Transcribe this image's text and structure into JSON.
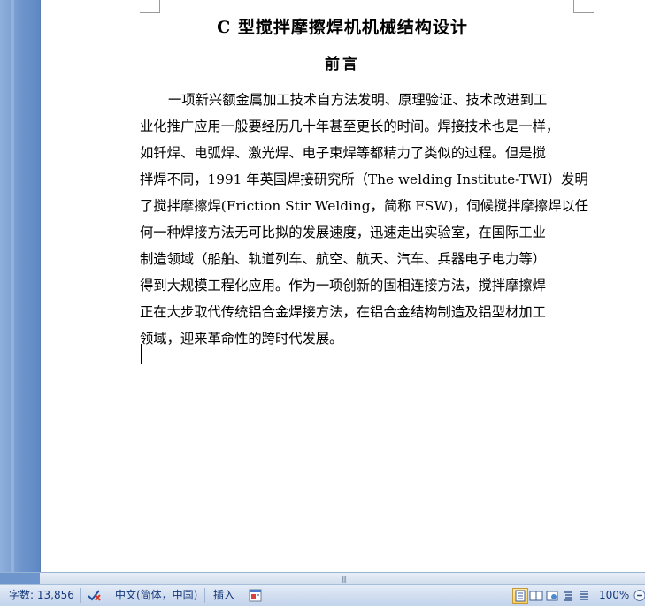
{
  "document": {
    "title": "C 型搅拌摩擦焊机机械结构设计",
    "heading": "前言",
    "paragraph_lines": [
      "一项新兴额金属加工技术自方法发明、原理验证、技术改进到工",
      "业化推广应用一般要经历几十年甚至更长的时间。焊接技术也是一样，",
      "如钎焊、电弧焊、激光焊、电子束焊等都精力了类似的过程。但是搅",
      "拌焊不同，1991 年英国焊接研究所（The welding Institute-TWI）发明",
      "了搅拌摩擦焊(Friction Stir Welding，简称 FSW)，伺候搅拌摩擦焊以任",
      "何一种焊接方法无可比拟的发展速度，迅速走出实验室，在国际工业",
      "制造领域（船舶、轨道列车、航空、航天、汽车、兵器电子电力等）",
      "得到大规模工程化应用。作为一项创新的固相连接方法，搅拌摩擦焊",
      "正在大步取代传统铝合金焊接方法，在铝合金结构制造及铝型材加工",
      "领域，迎来革命性的跨时代发展。"
    ]
  },
  "statusbar": {
    "word_count": "字数: 13,856",
    "language": "中文(简体，中国)",
    "insert_mode": "插入",
    "zoom": "100%",
    "spellcheck_icon": "spellcheck-icon",
    "macro_icon": "macro-icon"
  },
  "colors": {
    "sidebar_blue": "#6e95cc",
    "statusbar_text": "#15387a",
    "active_view": "#ffcf5a"
  }
}
